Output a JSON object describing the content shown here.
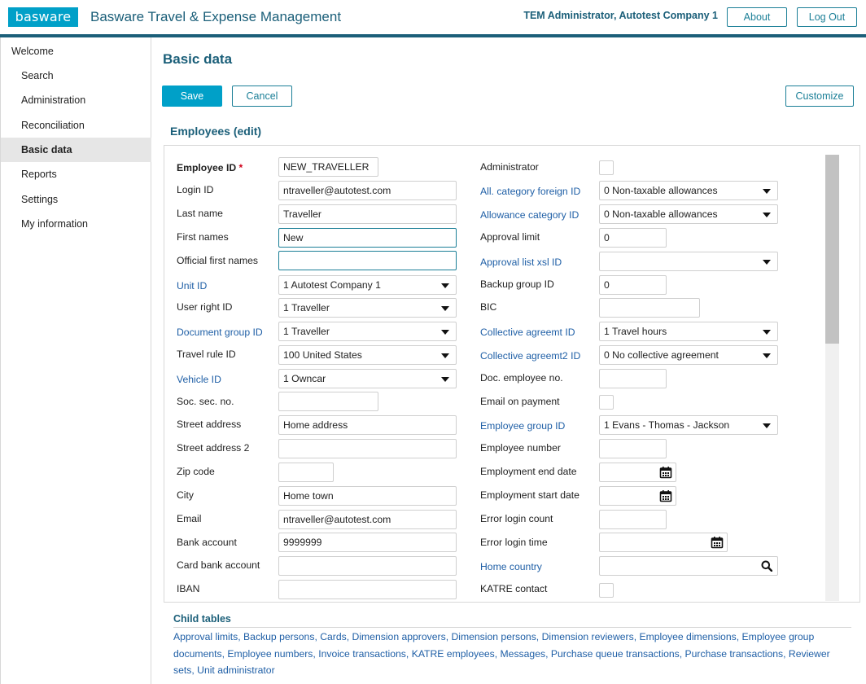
{
  "header": {
    "logo": "basware",
    "app_title": "Basware Travel & Expense Management",
    "user": "TEM Administrator, Autotest Company 1",
    "about": "About",
    "logout": "Log Out"
  },
  "sidebar": {
    "items": [
      {
        "label": "Welcome"
      },
      {
        "label": "Search"
      },
      {
        "label": "Administration"
      },
      {
        "label": "Reconciliation"
      },
      {
        "label": "Basic data"
      },
      {
        "label": "Reports"
      },
      {
        "label": "Settings"
      },
      {
        "label": "My information"
      }
    ]
  },
  "page": {
    "title": "Basic data",
    "save": "Save",
    "cancel": "Cancel",
    "customize": "Customize",
    "section_title": "Employees (edit)"
  },
  "form": {
    "left": [
      {
        "label": "Employee ID",
        "value": "NEW_TRAVELLER",
        "required": "*"
      },
      {
        "label": "Login ID",
        "value": "ntraveller@autotest.com"
      },
      {
        "label": "Last name",
        "value": "Traveller"
      },
      {
        "label": "First names",
        "value": "New"
      },
      {
        "label": "Official first names",
        "value": ""
      },
      {
        "label": "Unit ID",
        "value": "1 Autotest Company 1"
      },
      {
        "label": "User right ID",
        "value": "1 Traveller"
      },
      {
        "label": "Document group ID",
        "value": "1 Traveller"
      },
      {
        "label": "Travel rule ID",
        "value": "100 United States"
      },
      {
        "label": "Vehicle ID",
        "value": "1 Owncar"
      },
      {
        "label": "Soc. sec. no.",
        "value": ""
      },
      {
        "label": "Street address",
        "value": "Home address"
      },
      {
        "label": "Street address 2",
        "value": ""
      },
      {
        "label": "Zip code",
        "value": ""
      },
      {
        "label": "City",
        "value": "Home town"
      },
      {
        "label": "Email",
        "value": "ntraveller@autotest.com"
      },
      {
        "label": "Bank account",
        "value": "9999999"
      },
      {
        "label": "Card bank account",
        "value": ""
      },
      {
        "label": "IBAN",
        "value": ""
      }
    ],
    "right": [
      {
        "label": "Administrator",
        "value": ""
      },
      {
        "label": "All. category foreign ID",
        "value": "0 Non-taxable allowances"
      },
      {
        "label": "Allowance category ID",
        "value": "0 Non-taxable allowances"
      },
      {
        "label": "Approval limit",
        "value": "0"
      },
      {
        "label": "Approval list xsl ID",
        "value": ""
      },
      {
        "label": "Backup group ID",
        "value": "0"
      },
      {
        "label": "BIC",
        "value": ""
      },
      {
        "label": "Collective agreemt ID",
        "value": "1 Travel hours"
      },
      {
        "label": "Collective agreemt2 ID",
        "value": "0 No collective agreement"
      },
      {
        "label": "Doc. employee no.",
        "value": ""
      },
      {
        "label": "Email on payment",
        "value": ""
      },
      {
        "label": "Employee group ID",
        "value": "1 Evans - Thomas - Jackson"
      },
      {
        "label": "Employee number",
        "value": ""
      },
      {
        "label": "Employment end date",
        "value": ""
      },
      {
        "label": "Employment start date",
        "value": ""
      },
      {
        "label": "Error login count",
        "value": ""
      },
      {
        "label": "Error login time",
        "value": ""
      },
      {
        "label": "Home country",
        "value": ""
      },
      {
        "label": "KATRE contact",
        "value": ""
      }
    ]
  },
  "child_tables": {
    "title": "Child tables",
    "links": [
      "Approval limits",
      "Backup persons",
      "Cards",
      "Dimension approvers",
      "Dimension persons",
      "Dimension reviewers",
      "Employee dimensions",
      "Employee group documents",
      "Employee numbers",
      "Invoice transactions",
      "KATRE employees",
      "Messages",
      "Purchase queue transactions",
      "Purchase transactions",
      "Reviewer sets",
      "Unit administrator"
    ]
  },
  "colors": {
    "brand": "#00a0c8",
    "header_line": "#1b5f79",
    "link": "#1f5fa6"
  }
}
